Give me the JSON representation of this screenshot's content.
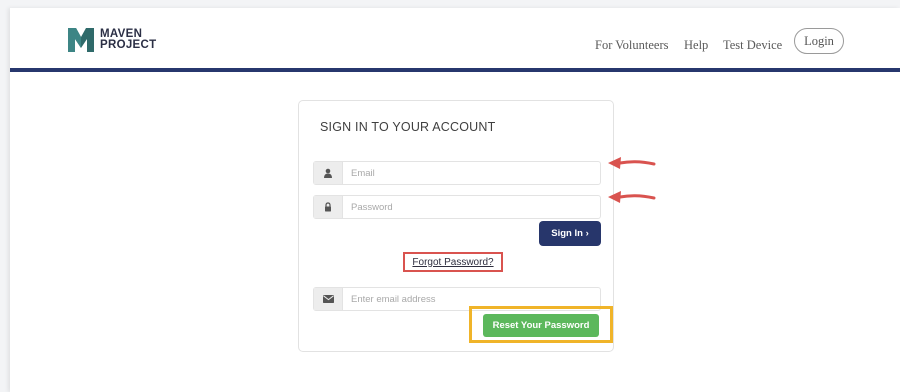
{
  "header": {
    "logo": {
      "line1": "MAVEN",
      "line2": "PROJECT"
    },
    "nav": [
      "For Volunteers",
      "Help",
      "Test Device"
    ],
    "login_label": "Login"
  },
  "card": {
    "title": "SIGN IN TO YOUR ACCOUNT",
    "email_placeholder": "Email",
    "password_placeholder": "Password",
    "signin_label": "Sign In ›",
    "forgot_label": "Forgot Password?",
    "reset_email_placeholder": "Enter email address",
    "reset_label": "Reset Your Password"
  },
  "icons": {
    "email": "user-icon",
    "password": "lock-icon",
    "reset_email": "envelope-icon",
    "annotation": "arrow-icon"
  },
  "colors": {
    "brand_navy": "#27366b",
    "reset_green": "#5cb85c",
    "annotation_red": "#d9534f",
    "annotation_yellow": "#f0b429"
  }
}
